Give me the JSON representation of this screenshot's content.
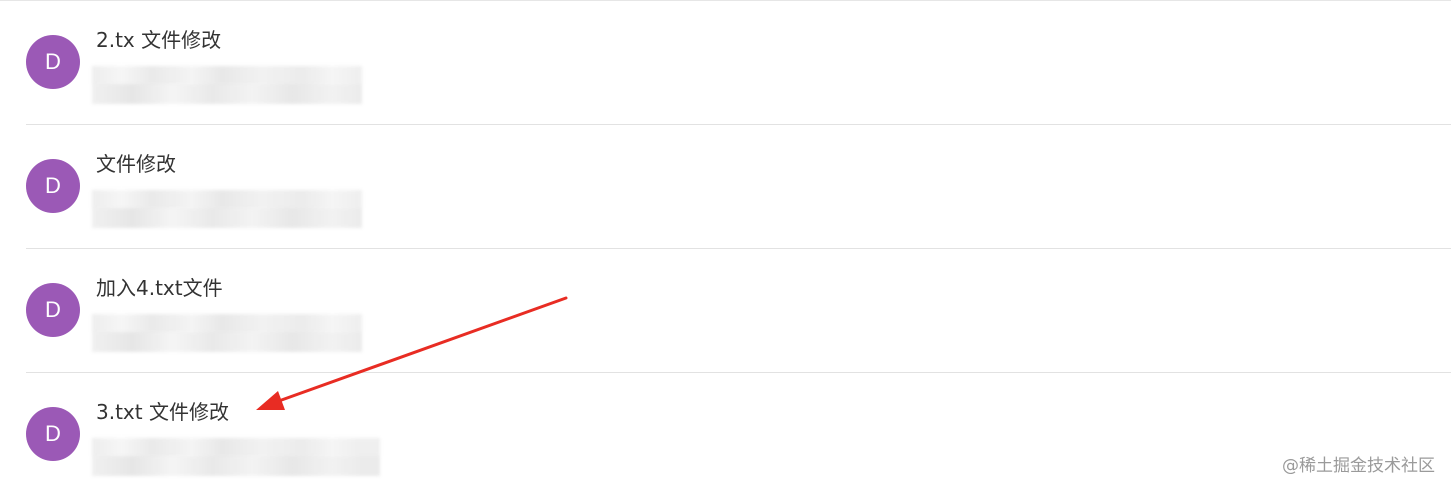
{
  "commits": [
    {
      "avatar_letter": "D",
      "title": "2.tx 文件修改"
    },
    {
      "avatar_letter": "D",
      "title": "文件修改"
    },
    {
      "avatar_letter": "D",
      "title": "加入4.txt文件"
    },
    {
      "avatar_letter": "D",
      "title": "3.txt 文件修改"
    }
  ],
  "colors": {
    "avatar_background": "#9b59b6",
    "annotation_arrow": "#e82c23",
    "divider": "#e2e2e2"
  },
  "watermark": "@稀土掘金技术社区"
}
